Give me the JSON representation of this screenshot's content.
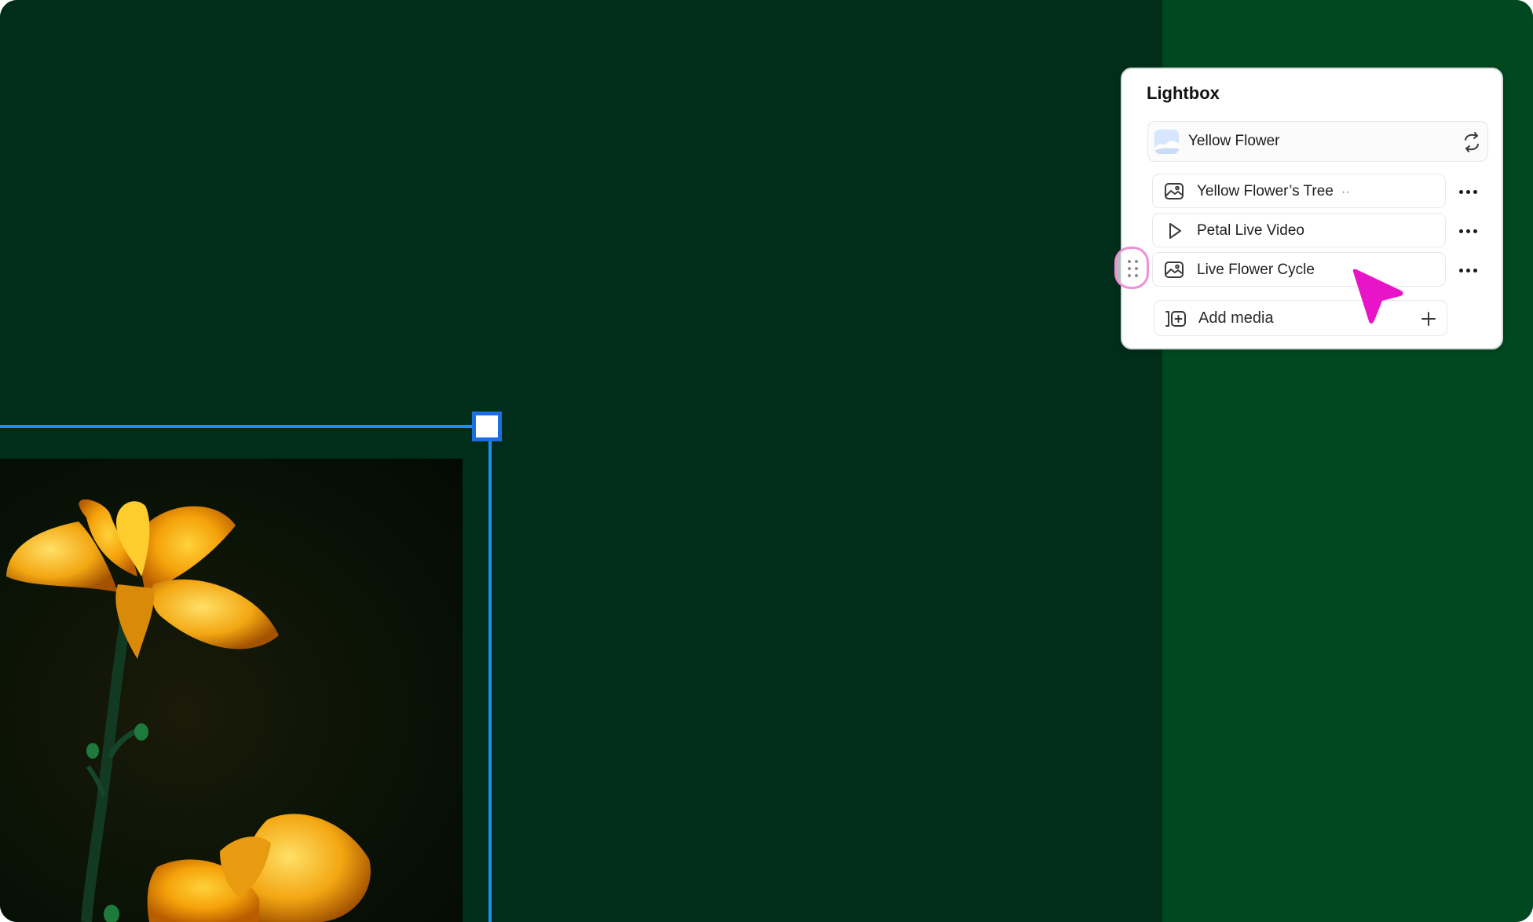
{
  "panel": {
    "title": "Lightbox",
    "source": {
      "label": "Yellow Flower",
      "thumb_icon": "landscape-thumbnail-icon",
      "action_icon": "swap-icon"
    },
    "media_items": [
      {
        "label": "Yellow Flower’s Tree",
        "icon": "image-icon",
        "suffix": "··"
      },
      {
        "label": "Petal Live Video",
        "icon": "play-icon"
      },
      {
        "label": "Live Flower Cycle",
        "icon": "image-icon"
      }
    ],
    "add_media": {
      "label": "Add media",
      "icon": "add-media-icon",
      "action_icon": "plus-icon"
    },
    "more_icon": "more-horizontal-icon",
    "drag_icon": "drag-handle-icon"
  },
  "colors": {
    "canvas_left": "#002e1a",
    "canvas_right": "#00481f",
    "selection": "#1d8ff0",
    "cursor": "#e815c8",
    "drag_highlight": "#ef8fd8"
  }
}
